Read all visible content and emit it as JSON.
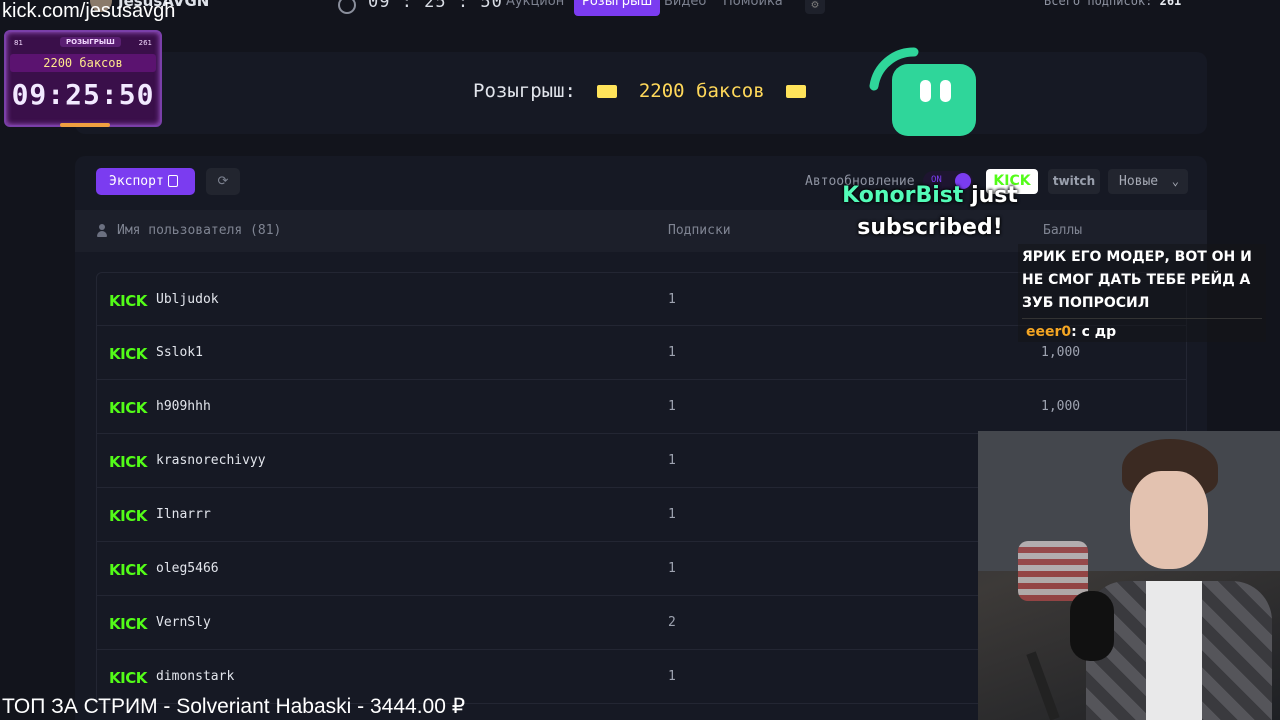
{
  "overlay": {
    "url": "kick.com/jesusavgh",
    "sub_alert": {
      "name": "KonorBist",
      "text": "just subscribed!"
    },
    "chat": {
      "message_tail": "ЯРИК ЕГО МОДЕР, ВОТ ОН И НЕ СМОГ ДАТЬ ТЕБЕ РЕЙД А ЗУБ ПОПРОСИЛ",
      "last_user": "eeer0",
      "last_text": ": с др"
    },
    "ticker": "ТОП ЗА СТРИМ - Solveriant Habaski - 3444.00 ₽"
  },
  "widget": {
    "left_count": "81",
    "label": "РОЗЫГРЫШ",
    "right_count": "261",
    "prize": "2200 баксов",
    "timer": "09:25:50"
  },
  "topbar": {
    "channel_name": "JesusAVGN",
    "time": "09 : 25 : 50",
    "tabs": [
      {
        "label": "Аукцион",
        "active": false
      },
      {
        "label": "Розыгрыш",
        "active": true
      },
      {
        "label": "Видео",
        "active": false
      },
      {
        "label": "Помойка",
        "active": false
      }
    ],
    "subs_total_label": "Всего подписок:",
    "subs_total_value": "261"
  },
  "prize": {
    "label": "Розыгрыш:",
    "amount": "2200 баксов"
  },
  "toolbar": {
    "export_label": "Экспорт",
    "auto_update_label": "Автообновление",
    "toggle_state": "ON",
    "source_kick": "KICK",
    "source_twitch": "twitch",
    "sort_value": "Новые"
  },
  "table": {
    "col_user": "Имя пользователя (81)",
    "col_subs": "Подписки",
    "col_points": "Баллы",
    "rows": [
      {
        "badge": "KICK",
        "user": "Ubljudok",
        "subs": "1",
        "points": ""
      },
      {
        "badge": "KICK",
        "user": "Sslok1",
        "subs": "1",
        "points": "1,000"
      },
      {
        "badge": "KICK",
        "user": "h909hhh",
        "subs": "1",
        "points": "1,000"
      },
      {
        "badge": "KICK",
        "user": "krasnorechivyy",
        "subs": "1",
        "points": ""
      },
      {
        "badge": "KICK",
        "user": "Ilnarrr",
        "subs": "1",
        "points": ""
      },
      {
        "badge": "KICK",
        "user": "oleg5466",
        "subs": "1",
        "points": ""
      },
      {
        "badge": "KICK",
        "user": "VernSly",
        "subs": "2",
        "points": ""
      },
      {
        "badge": "KICK",
        "user": "dimonstark",
        "subs": "1",
        "points": ""
      }
    ]
  },
  "colors": {
    "accent": "#7b3cf0",
    "kick_green": "#53fc18",
    "panel_bg": "#161924",
    "page_bg": "#12141c"
  }
}
